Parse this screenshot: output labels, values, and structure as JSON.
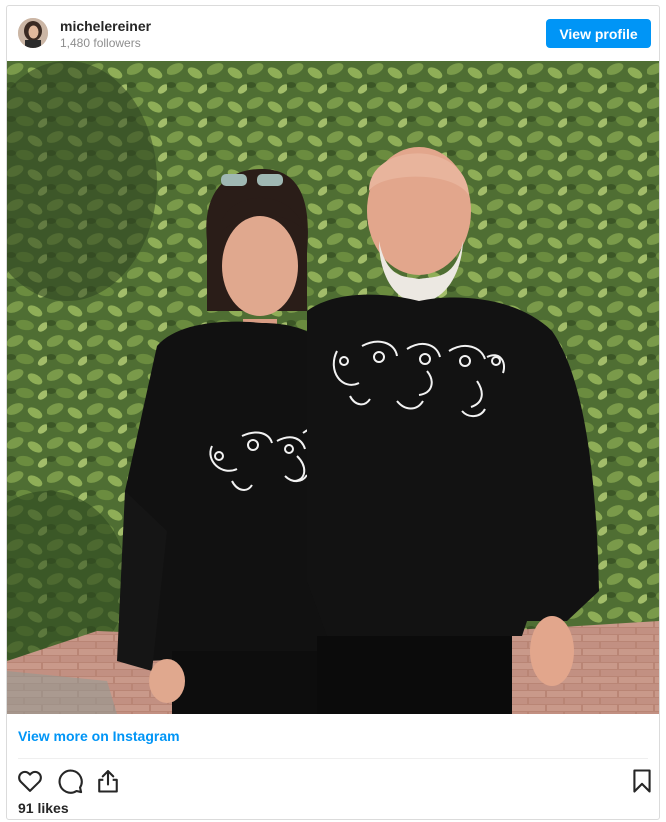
{
  "header": {
    "username": "michelereiner",
    "followers": "1,480 followers",
    "view_profile_label": "View profile"
  },
  "post": {
    "image_alt": "Photo posted by michelereiner",
    "view_more_label": "View more on Instagram",
    "likes": "91 likes"
  },
  "actions": {
    "icons": [
      "heart-icon",
      "comment-icon",
      "share-icon",
      "bookmark-icon"
    ]
  },
  "colors": {
    "accent": "#0095f6",
    "text": "#262626",
    "muted": "#8e8e8e",
    "border": "#dbdbdb"
  }
}
